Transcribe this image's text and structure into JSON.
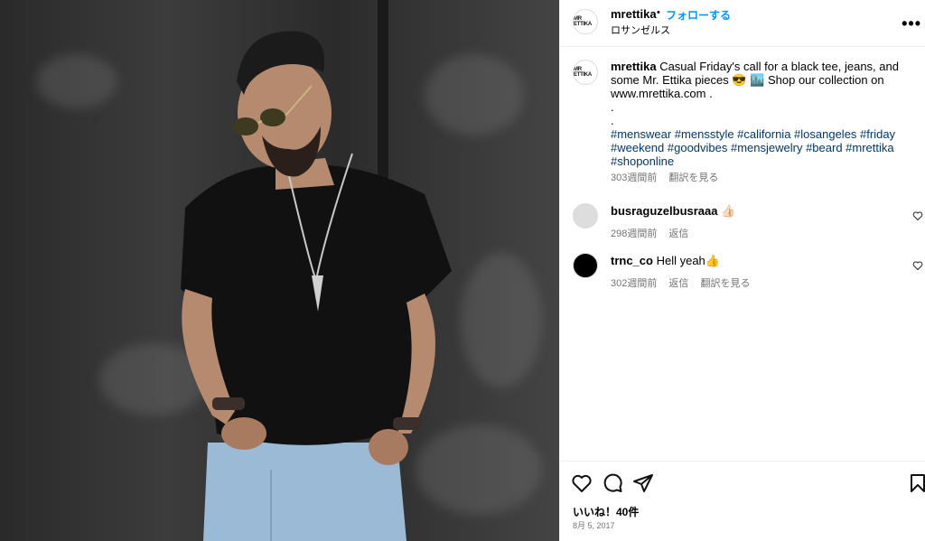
{
  "post": {
    "username": "mrettika",
    "follow_label": "フォローする",
    "separator": "•",
    "location": "ロサンゼルス",
    "avatar_text": "MR ETTIKA"
  },
  "caption": {
    "username": "mrettika",
    "line1": " Casual Friday's call for a black tee, jeans, and some Mr. Ettika pieces 😎 🏙️ Shop our collection on www.mrettika.com .",
    "dot1": ".",
    "dot2": ".",
    "hashtags": "#menswear #mensstyle #california #losangeles #friday #weekend #goodvibes #mensjewelry #beard #mrettika #shoponline",
    "time": "303週間前",
    "translate": "翻訳を見る"
  },
  "comments": [
    {
      "username": "busraguzelbusraaa",
      "text": " 👍🏻",
      "time": "298週間前",
      "reply": "返信",
      "translate": ""
    },
    {
      "username": "trnc_co",
      "text": " Hell yeah👍",
      "time": "302週間前",
      "reply": "返信",
      "translate": "翻訳を見る"
    }
  ],
  "footer": {
    "likes": "いいね！40件",
    "date": "8月 5, 2017"
  },
  "icons": {
    "more": "more-options-icon",
    "like": "heart-icon",
    "comment": "comment-icon",
    "share": "share-icon",
    "save": "bookmark-icon"
  },
  "colors": {
    "follow": "#0095f6",
    "hashtag": "#00376b",
    "muted": "#737373",
    "border": "#efefef"
  }
}
